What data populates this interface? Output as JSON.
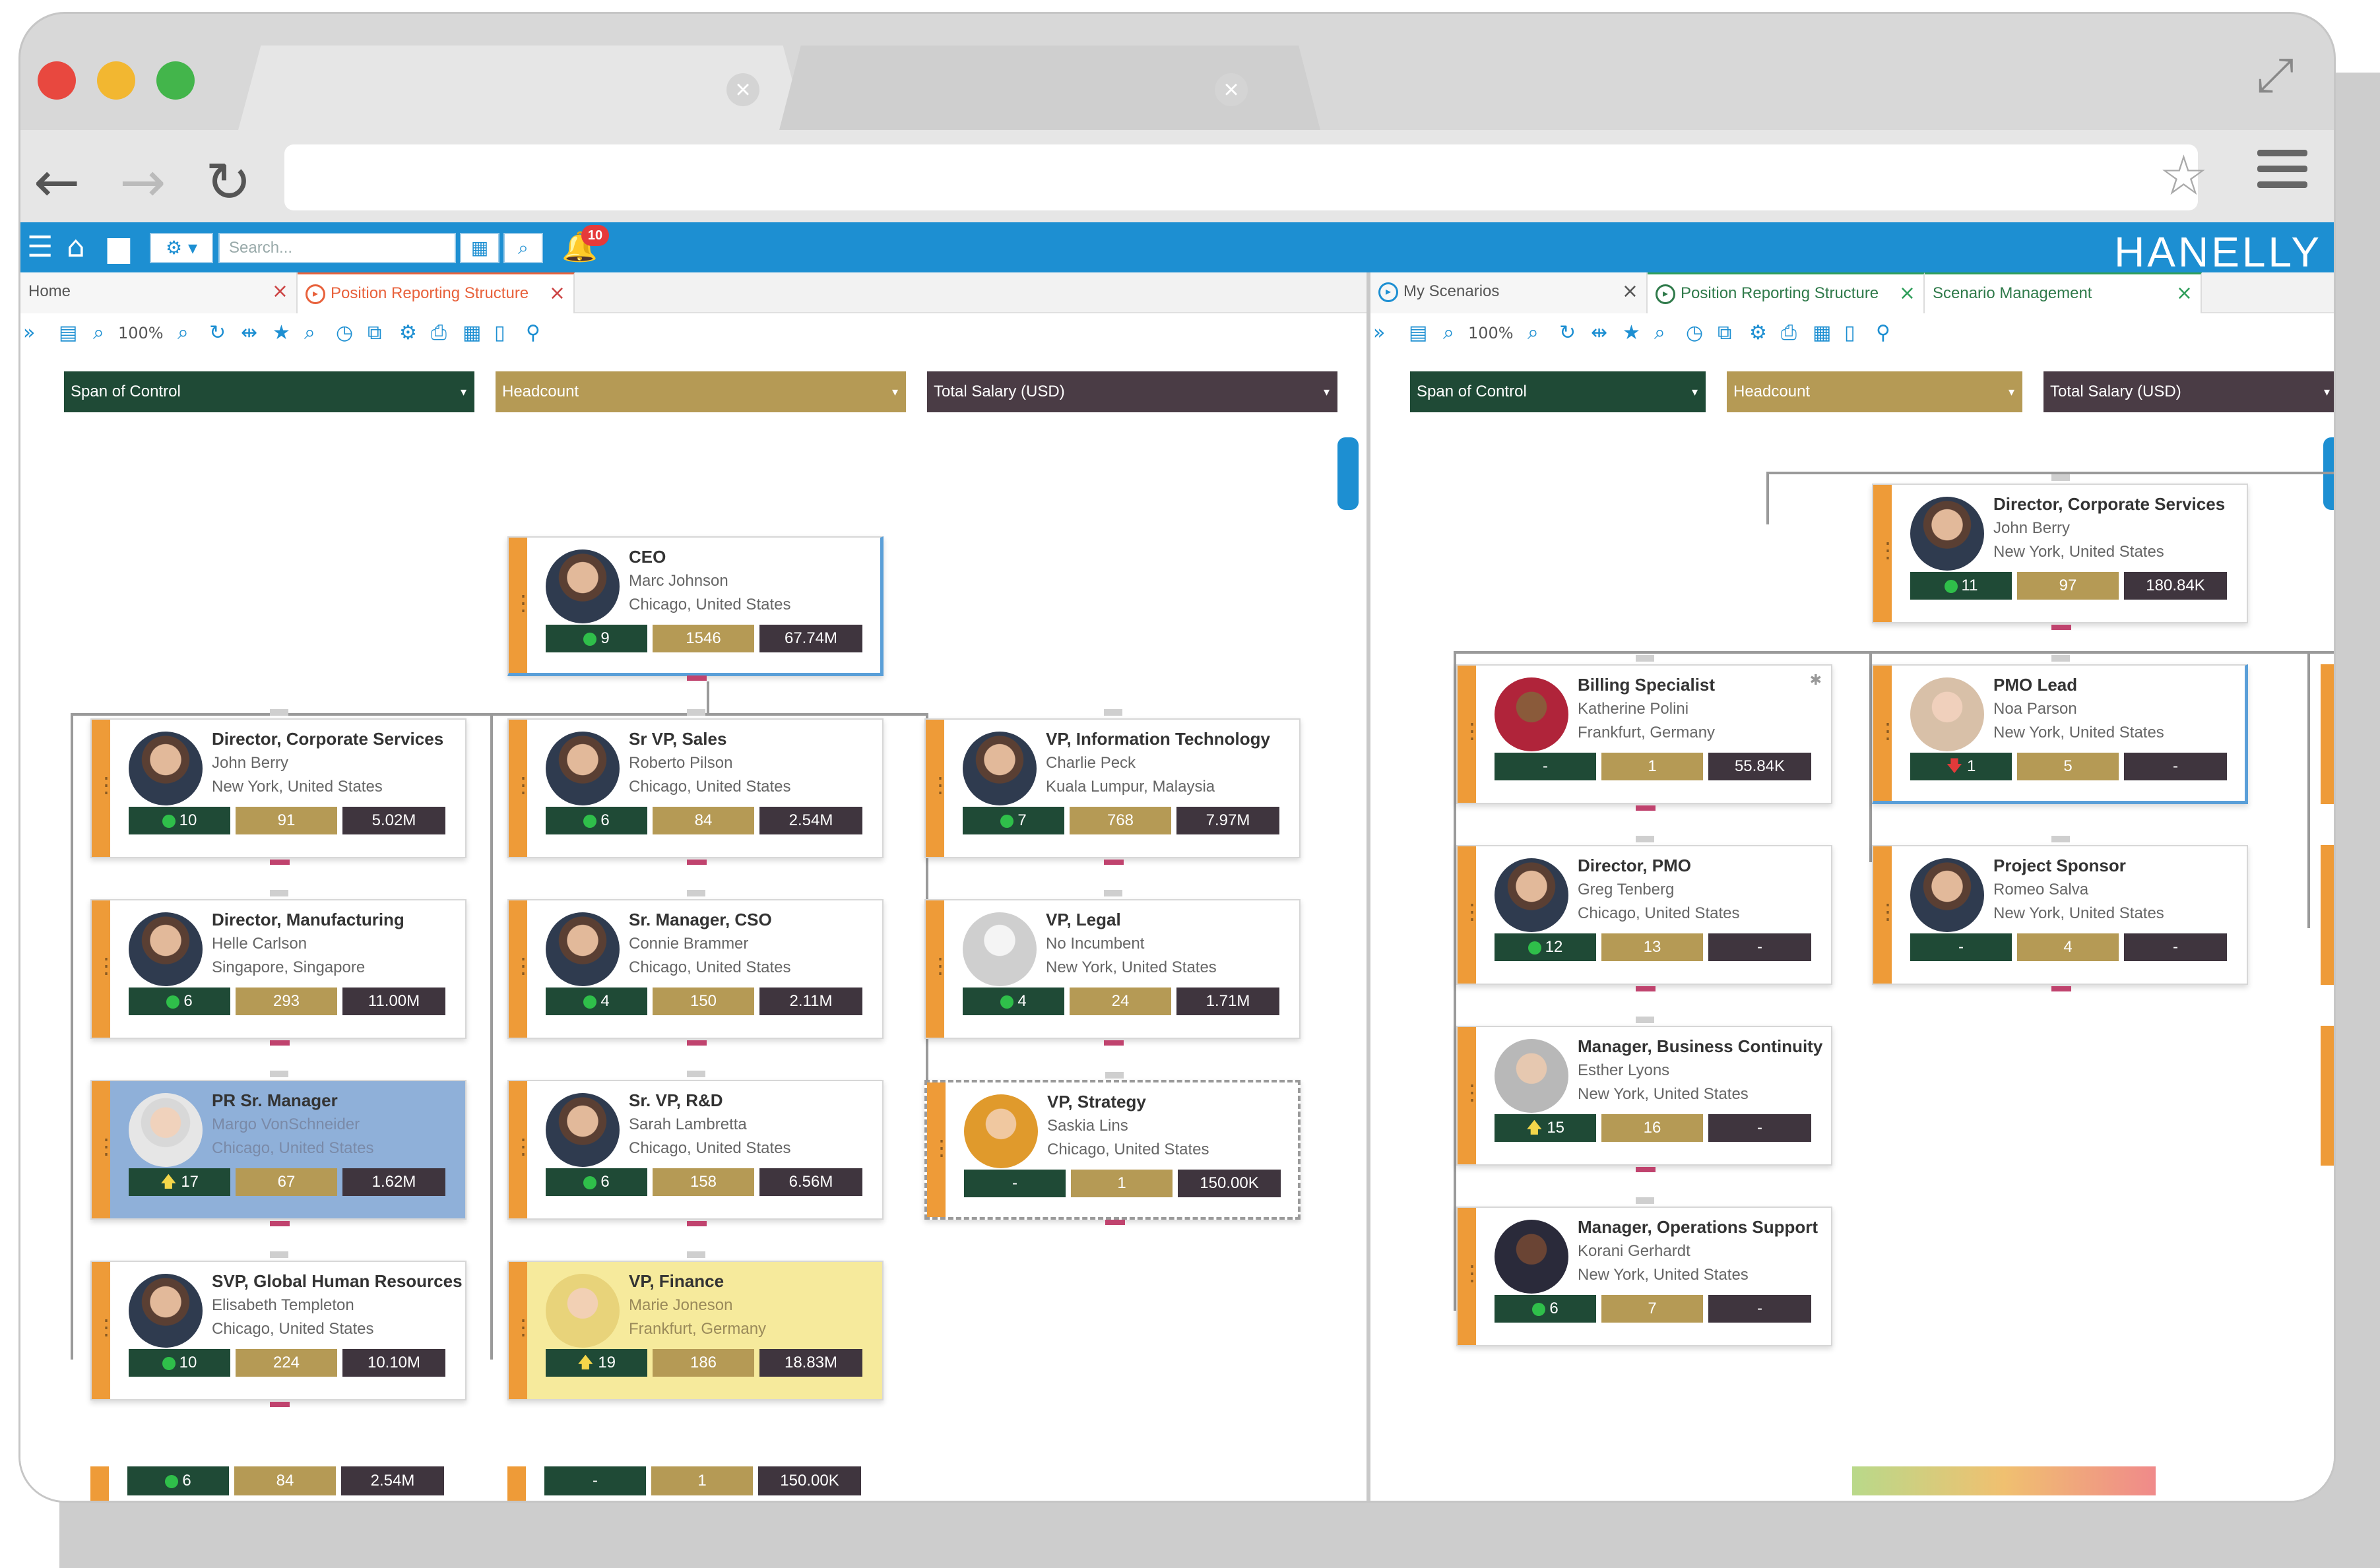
{
  "browser": {
    "tab1_close": "×",
    "tab2_close": "×",
    "back": "←",
    "forward": "→",
    "reload": "↻",
    "star": "☆",
    "expand": "⤢"
  },
  "app": {
    "logo": "HANELLY",
    "search_placeholder": "Search...",
    "notif_count": "10",
    "brand_color": "#1d8fd2"
  },
  "left": {
    "tabs": [
      {
        "label": "Home"
      },
      {
        "label": "Position Reporting Structure"
      }
    ],
    "zoom": "100%",
    "metrics": [
      "Span of Control",
      "Headcount",
      "Total Salary (USD)"
    ],
    "cards": [
      {
        "title": "CEO",
        "name": "Marc Johnson",
        "loc": "Chicago, United States",
        "s1": "9",
        "s2": "1546",
        "s3": "67.74M"
      },
      {
        "title": "Director, Corporate Services",
        "name": "John Berry",
        "loc": "New York, United States",
        "s1": "10",
        "s2": "91",
        "s3": "5.02M"
      },
      {
        "title": "Sr VP, Sales",
        "name": "Roberto Pilson",
        "loc": "Chicago, United States",
        "s1": "6",
        "s2": "84",
        "s3": "2.54M"
      },
      {
        "title": "VP, Information Technology",
        "name": "Charlie Peck",
        "loc": "Kuala Lumpur, Malaysia",
        "s1": "7",
        "s2": "768",
        "s3": "7.97M"
      },
      {
        "title": "Director, Manufacturing",
        "name": "Helle Carlson",
        "loc": "Singapore, Singapore",
        "s1": "6",
        "s2": "293",
        "s3": "11.00M"
      },
      {
        "title": "Sr. Manager, CSO",
        "name": "Connie Brammer",
        "loc": "Chicago, United States",
        "s1": "4",
        "s2": "150",
        "s3": "2.11M"
      },
      {
        "title": "VP, Legal",
        "name": "No Incumbent",
        "loc": "New York, United States",
        "s1": "4",
        "s2": "24",
        "s3": "1.71M"
      },
      {
        "title": "PR Sr. Manager",
        "name": "Margo VonSchneider",
        "loc": "Chicago, United States",
        "s1": "17",
        "s2": "67",
        "s3": "1.62M"
      },
      {
        "title": "Sr. VP, R&D",
        "name": "Sarah Lambretta",
        "loc": "Chicago, United States",
        "s1": "6",
        "s2": "158",
        "s3": "6.56M"
      },
      {
        "title": "VP, Strategy",
        "name": "Saskia Lins",
        "loc": "Chicago, United States",
        "s1": "-",
        "s2": "1",
        "s3": "150.00K"
      },
      {
        "title": "SVP, Global Human Resources",
        "name": "Elisabeth Templeton",
        "loc": "Chicago, United States",
        "s1": "10",
        "s2": "224",
        "s3": "10.10M"
      },
      {
        "title": "VP, Finance",
        "name": "Marie Joneson",
        "loc": "Frankfurt, Germany",
        "s1": "19",
        "s2": "186",
        "s3": "18.83M"
      }
    ],
    "bottom": [
      {
        "s1": "6",
        "s2": "84",
        "s3": "2.54M"
      },
      {
        "s1": "-",
        "s2": "1",
        "s3": "150.00K"
      }
    ]
  },
  "right": {
    "tabs": [
      {
        "label": "My Scenarios"
      },
      {
        "label": "Position Reporting Structure"
      },
      {
        "label": "Scenario Management"
      }
    ],
    "zoom": "100%",
    "metrics": [
      "Span of Control",
      "Headcount",
      "Total Salary (USD)"
    ],
    "cards": [
      {
        "title": "Director, Corporate Services",
        "name": "John Berry",
        "loc": "New York, United States",
        "s1": "11",
        "s2": "97",
        "s3": "180.84K"
      },
      {
        "title": "Billing Specialist",
        "name": "Katherine Polini",
        "loc": "Frankfurt, Germany",
        "s1": "-",
        "s2": "1",
        "s3": "55.84K"
      },
      {
        "title": "PMO Lead",
        "name": "Noa Parson",
        "loc": "New York, United States",
        "s1": "1",
        "s2": "5",
        "s3": "-"
      },
      {
        "title": "Director, PMO",
        "name": "Greg Tenberg",
        "loc": "Chicago, United States",
        "s1": "12",
        "s2": "13",
        "s3": "-"
      },
      {
        "title": "Project Sponsor",
        "name": "Romeo Salva",
        "loc": "New York, United States",
        "s1": "-",
        "s2": "4",
        "s3": "-"
      },
      {
        "title": "Manager, Business Continuity",
        "name": "Esther Lyons",
        "loc": "New York, United States",
        "s1": "15",
        "s2": "16",
        "s3": "-"
      },
      {
        "title": "Manager, Operations Support",
        "name": "Korani Gerhardt",
        "loc": "New York, United States",
        "s1": "6",
        "s2": "7",
        "s3": "-"
      }
    ]
  }
}
